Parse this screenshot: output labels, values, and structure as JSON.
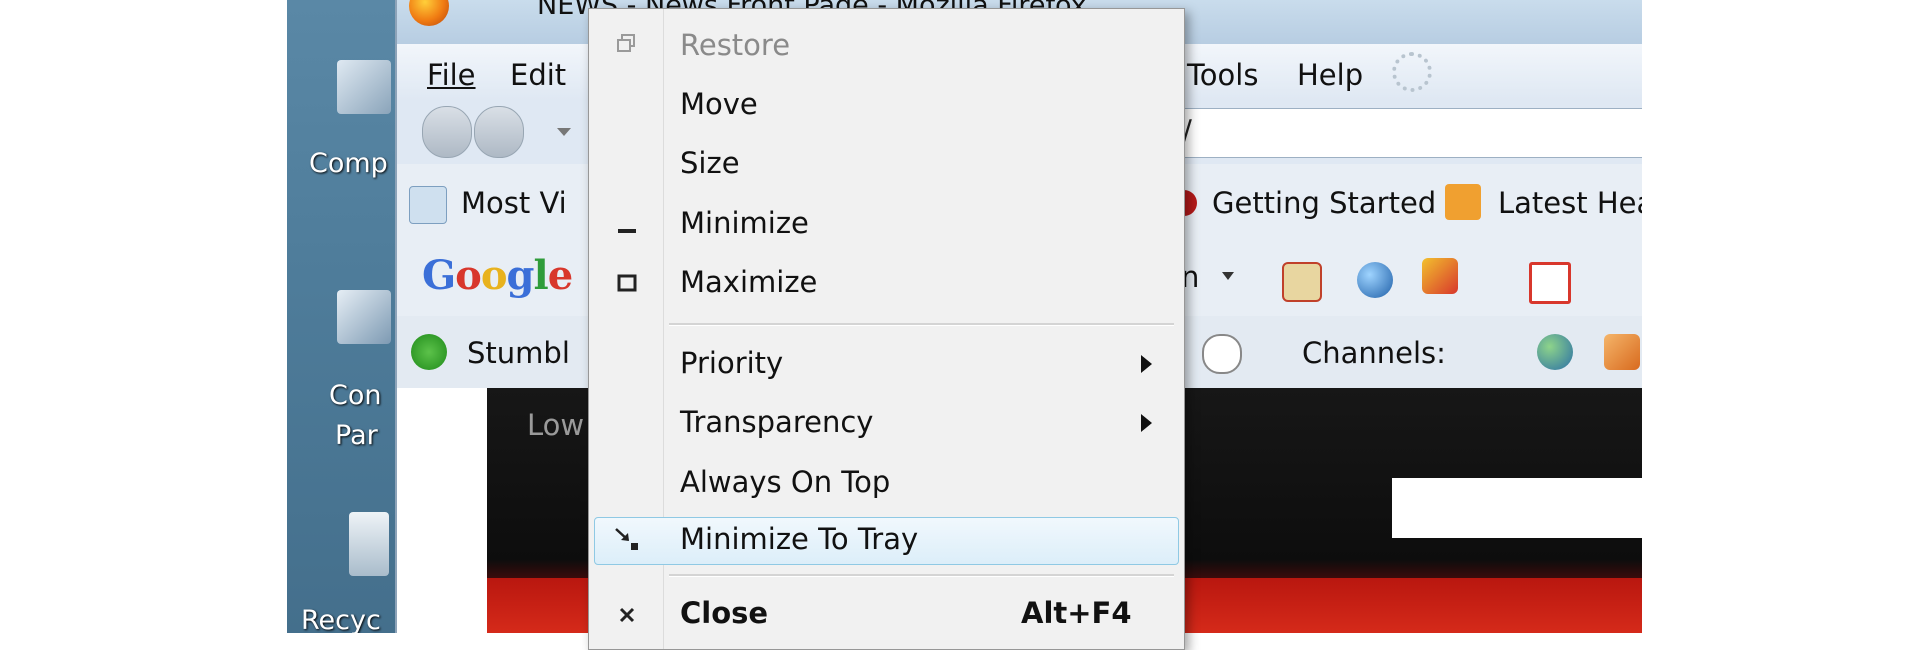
{
  "desktop": {
    "icons": [
      {
        "name": "computer-icon",
        "label": "Comp"
      },
      {
        "name": "control-panel-icon",
        "label": "Con"
      },
      {
        "name": "control-panel-icon-line2",
        "label": "Par"
      },
      {
        "name": "recycle-bin-icon",
        "label": "Recyc"
      }
    ]
  },
  "browser": {
    "title": "NEWS - News Front Page - Mozilla Firefox",
    "menus": [
      "File",
      "Edit",
      "Tools",
      "Help"
    ],
    "url": "s/",
    "bookmarks": [
      "Most Vi",
      "Getting Started",
      "Latest Hea"
    ],
    "google_logo": "Google",
    "toolbar_partial": "n",
    "stumble": "Stumbl",
    "channels_label": "Channels:",
    "page_partial_text": "Low"
  },
  "context_menu": {
    "items": [
      {
        "label": "Restore",
        "icon": "restore-icon",
        "disabled": true
      },
      {
        "label": "Move"
      },
      {
        "label": "Size"
      },
      {
        "label": "Minimize",
        "icon": "minimize-icon"
      },
      {
        "label": "Maximize",
        "icon": "maximize-icon"
      },
      {
        "label": "Priority",
        "submenu": true
      },
      {
        "label": "Transparency",
        "submenu": true
      },
      {
        "label": "Always On Top"
      },
      {
        "label": "Minimize To Tray",
        "icon": "minimize-to-tray-icon",
        "highlighted": true
      },
      {
        "label": "Close",
        "icon": "close-icon",
        "shortcut": "Alt+F4",
        "bold": true
      }
    ]
  },
  "colors": {
    "menu_hover_border": "#8fc9e4",
    "desktop": "#4f7d9b"
  }
}
